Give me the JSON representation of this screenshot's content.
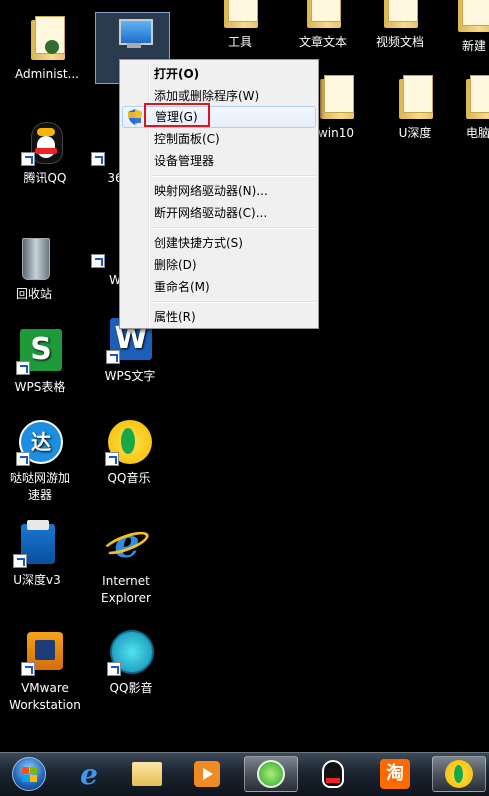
{
  "desktop": {
    "top_folders": [
      "工具",
      "文章文本",
      "视频文档",
      "新建"
    ],
    "mid_folders": [
      "win10",
      "U深度",
      "电脑"
    ],
    "left_icons": [
      {
        "label": "Administ..."
      },
      {
        "label": "腾讯QQ"
      },
      {
        "label": "回收站"
      },
      {
        "label": "WPS表格"
      },
      {
        "label": "哒哒网游加\n速器"
      },
      {
        "label": "U深度v3"
      },
      {
        "label": "VMware\nWorkstation"
      }
    ],
    "second_col_icons": [
      {
        "label": "计"
      },
      {
        "label": "36"
      },
      {
        "label": "W"
      },
      {
        "label": "WPS文字"
      },
      {
        "label": "QQ音乐"
      },
      {
        "label": "Internet\nExplorer"
      },
      {
        "label": "QQ影音"
      }
    ]
  },
  "context_menu": {
    "items": [
      {
        "label": "打开(O)",
        "bold": true
      },
      {
        "label": "添加或删除程序(W)"
      },
      {
        "label": "管理(G)",
        "highlighted": true,
        "icon": "uac-shield-icon"
      },
      {
        "label": "控制面板(C)"
      },
      {
        "label": "设备管理器"
      },
      {
        "label": "映射网络驱动器(N)..."
      },
      {
        "label": "断开网络驱动器(C)..."
      },
      {
        "label": "创建快捷方式(S)"
      },
      {
        "label": "删除(D)"
      },
      {
        "label": "重命名(M)"
      },
      {
        "label": "属性(R)"
      }
    ]
  },
  "taskbar": {
    "items": [
      "start-orb-icon",
      "ie-icon",
      "explorer-icon",
      "media-player-icon",
      "360-browser-icon",
      "qq-icon",
      "taobao-icon",
      "qq-music-icon"
    ]
  },
  "colors": {
    "highlight_box": "#e0141a",
    "menu_bg": "#f0f0f0"
  }
}
